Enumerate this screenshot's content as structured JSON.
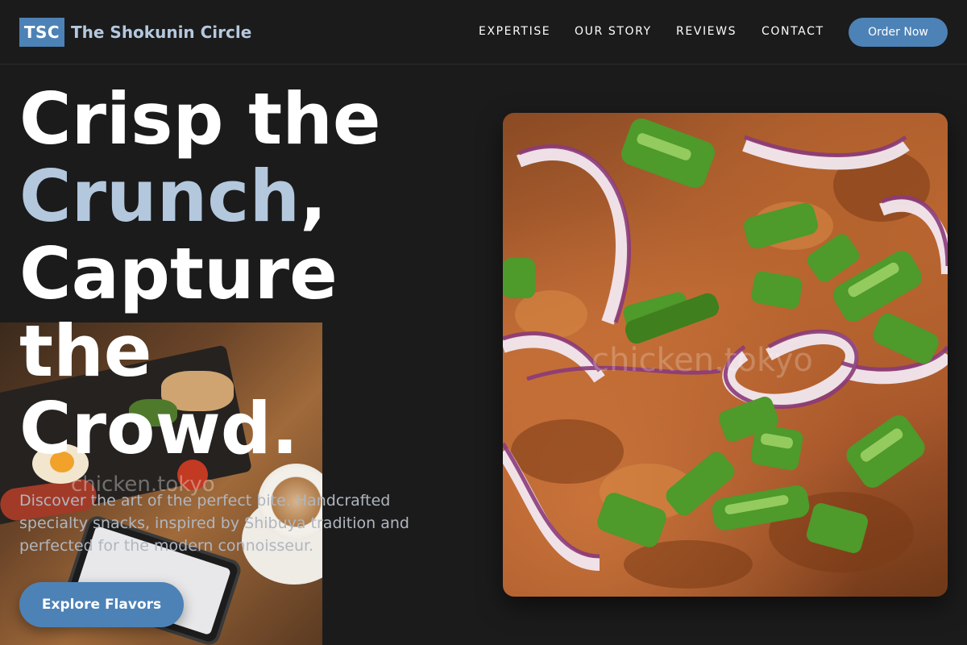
{
  "header": {
    "logo_text": "TSC",
    "brand_name": "The Shokunin Circle",
    "nav": [
      {
        "label": "EXPERTISE"
      },
      {
        "label": "OUR STORY"
      },
      {
        "label": "REVIEWS"
      },
      {
        "label": "CONTACT"
      }
    ],
    "cta_label": "Order Now"
  },
  "hero": {
    "title_line1": "Crisp the",
    "title_accent": "Crunch",
    "title_comma": ",",
    "title_line3": "Capture",
    "title_line4": "the",
    "title_line5": "Crowd.",
    "description": "Discover the art of the perfect bite. Handcrafted specialty snacks, inspired by Shibuya tradition and perfected for the modern connoisseur.",
    "button_label": "Explore Flavors"
  },
  "images": {
    "left_watermark": "chicken.tokyo",
    "right_watermark": "chicken.tokyo"
  },
  "colors": {
    "accent": "#4d82b6",
    "accent_light": "#b3c7dd",
    "background": "#1b1b1b",
    "text": "#ffffff",
    "muted_text": "#b0b6bf"
  }
}
